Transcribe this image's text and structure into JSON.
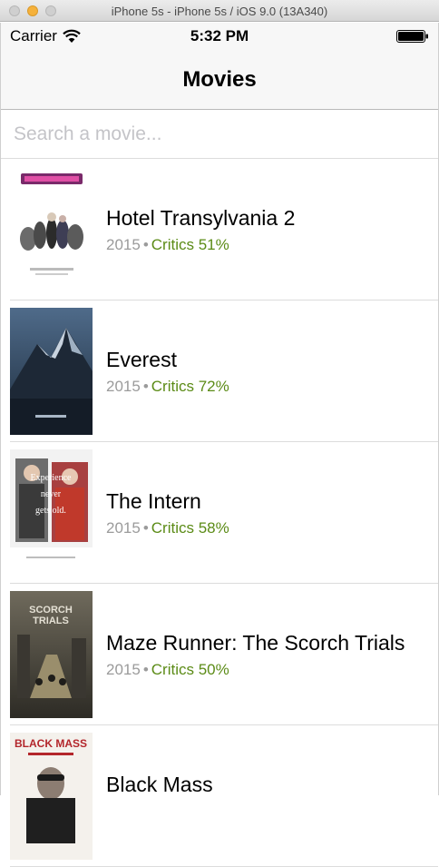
{
  "window": {
    "title": "iPhone 5s - iPhone 5s / iOS 9.0 (13A340)"
  },
  "status_bar": {
    "carrier": "Carrier",
    "time": "5:32 PM",
    "wifi_icon": "wifi-icon",
    "battery_icon": "battery-icon"
  },
  "nav": {
    "title": "Movies"
  },
  "search": {
    "placeholder": "Search a movie...",
    "value": ""
  },
  "movies": [
    {
      "title": "Hotel Transylvania 2",
      "year": "2015",
      "separator": "•",
      "critics": "Critics 51%",
      "poster_icon": "hotel-transylvania-poster"
    },
    {
      "title": "Everest",
      "year": "2015",
      "separator": "•",
      "critics": "Critics 72%",
      "poster_icon": "everest-poster"
    },
    {
      "title": "The Intern",
      "year": "2015",
      "separator": "•",
      "critics": "Critics 58%",
      "poster_icon": "intern-poster",
      "poster_text": "Experience never gets old."
    },
    {
      "title": "Maze Runner: The Scorch Trials",
      "year": "2015",
      "separator": "•",
      "critics": "Critics 50%",
      "poster_icon": "maze-runner-poster",
      "poster_text": "SCORCH TRIALS"
    },
    {
      "title": "Black Mass",
      "year": "",
      "separator": "",
      "critics": "",
      "poster_icon": "black-mass-poster",
      "poster_text": "BLACK MASS"
    }
  ],
  "colors": {
    "critics_green": "#5b8b16",
    "meta_gray": "#9b9b9b",
    "navbar_bg": "#f7f7f7"
  }
}
